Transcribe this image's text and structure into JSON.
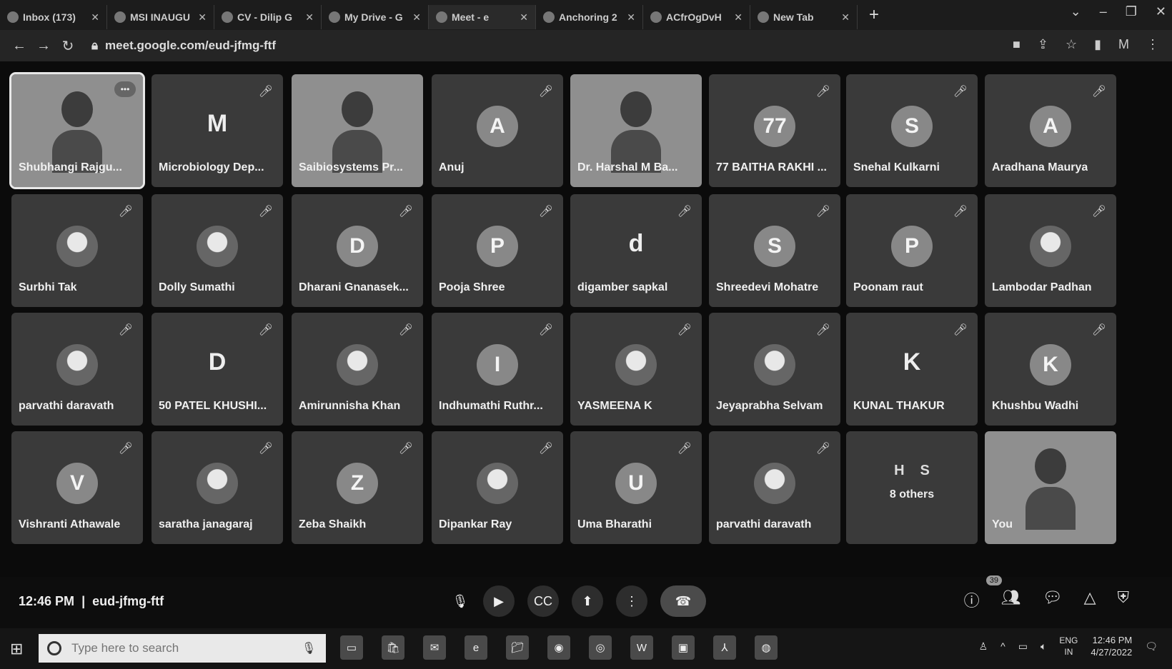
{
  "browser": {
    "tabs": [
      {
        "label": "Inbox (173)"
      },
      {
        "label": "MSI INAUGU"
      },
      {
        "label": "CV - Dilip G"
      },
      {
        "label": "My Drive - G"
      },
      {
        "label": "Meet - e"
      },
      {
        "label": "Anchoring 2"
      },
      {
        "label": "ACfrOgDvH"
      },
      {
        "label": "New Tab"
      }
    ],
    "url": "meet.google.com/eud-jfmg-ftf"
  },
  "meet": {
    "tiles": [
      {
        "name": "Shubhangi Rajgu...",
        "type": "video",
        "selected": true,
        "more": "•••"
      },
      {
        "name": "Microbiology Dep...",
        "type": "letter",
        "initial": "M",
        "muted": true
      },
      {
        "name": "Saibiosystems Pr...",
        "type": "video"
      },
      {
        "name": "Anuj",
        "type": "avatar",
        "initial": "A",
        "muted": true
      },
      {
        "name": "Dr. Harshal M Ba...",
        "type": "video"
      },
      {
        "name": "77 BAITHA RAKHI ...",
        "type": "avatar",
        "initial": "77",
        "muted": true
      },
      {
        "name": "Snehal Kulkarni",
        "type": "avatar",
        "initial": "S",
        "muted": true
      },
      {
        "name": "Aradhana Maurya",
        "type": "avatar",
        "initial": "A",
        "muted": true
      },
      {
        "name": "Surbhi Tak",
        "type": "photo",
        "muted": true
      },
      {
        "name": "Dolly Sumathi",
        "type": "photo",
        "muted": true
      },
      {
        "name": "Dharani Gnanasek...",
        "type": "avatar",
        "initial": "D",
        "muted": true
      },
      {
        "name": "Pooja Shree",
        "type": "avatar",
        "initial": "P",
        "muted": true
      },
      {
        "name": "digamber sapkal",
        "type": "letter",
        "initial": "d",
        "muted": true
      },
      {
        "name": "Shreedevi Mohatre",
        "type": "avatar",
        "initial": "S",
        "muted": true
      },
      {
        "name": "Poonam raut",
        "type": "avatar",
        "initial": "P",
        "muted": true
      },
      {
        "name": "Lambodar Padhan",
        "type": "photo",
        "muted": true
      },
      {
        "name": "parvathi daravath",
        "type": "photo",
        "muted": true
      },
      {
        "name": "50 PATEL KHUSHI...",
        "type": "letter",
        "initial": "D",
        "muted": true
      },
      {
        "name": "Amirunnisha Khan",
        "type": "photo",
        "muted": true
      },
      {
        "name": "Indhumathi Ruthr...",
        "type": "avatar",
        "initial": "I",
        "muted": true
      },
      {
        "name": "YASMEENA K",
        "type": "photo",
        "muted": true
      },
      {
        "name": "Jeyaprabha Selvam",
        "type": "photo",
        "muted": true
      },
      {
        "name": "KUNAL THAKUR",
        "type": "letter",
        "initial": "K",
        "muted": true
      },
      {
        "name": "Khushbu Wadhi",
        "type": "avatar",
        "initial": "K",
        "muted": true
      },
      {
        "name": "Vishranti Athawale",
        "type": "avatar",
        "initial": "V",
        "muted": true
      },
      {
        "name": "saratha janagaraj",
        "type": "photo",
        "muted": true
      },
      {
        "name": "Zeba Shaikh",
        "type": "avatar",
        "initial": "Z",
        "muted": true
      },
      {
        "name": "Dipankar Ray",
        "type": "photo",
        "muted": true
      },
      {
        "name": "Uma Bharathi",
        "type": "avatar",
        "initial": "U",
        "muted": true
      },
      {
        "name": "parvathi daravath",
        "type": "photo",
        "muted": true
      },
      {
        "name": "8 others",
        "type": "others",
        "initials": [
          "H",
          "S"
        ]
      },
      {
        "name": "You",
        "type": "video"
      }
    ],
    "time": "12:46 PM",
    "separator": "|",
    "code": "eud-jfmg-ftf",
    "participant_count": "39"
  },
  "taskbar": {
    "search_placeholder": "Type here to search",
    "lang": "ENG",
    "region": "IN",
    "time": "12:46 PM",
    "date": "4/27/2022"
  }
}
